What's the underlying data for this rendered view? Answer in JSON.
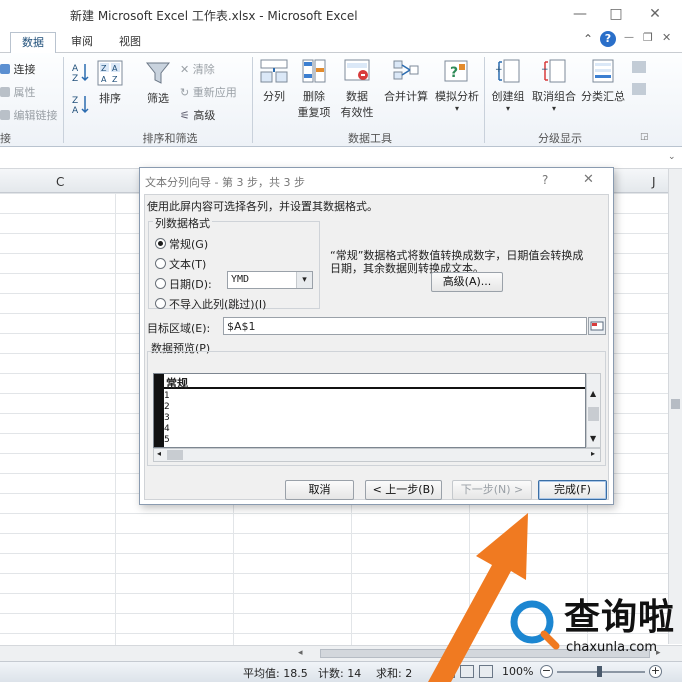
{
  "window": {
    "title": "新建 Microsoft Excel 工作表.xlsx  -  Microsoft Excel",
    "controls": [
      "—",
      "□",
      "✕"
    ]
  },
  "tabs": [
    {
      "label": "数据",
      "active": true
    },
    {
      "label": "审阅",
      "active": false
    },
    {
      "label": "视图",
      "active": false
    }
  ],
  "ribbon_right_icons": [
    "⌃",
    "?",
    "—",
    "❐",
    "✕"
  ],
  "ribbon": {
    "connections": {
      "items": [
        "连接",
        "属性",
        "编辑链接"
      ],
      "label": "接"
    },
    "sort_filter": {
      "sort_label": "排序",
      "filter_label": "筛选",
      "clear": "清除",
      "reapply": "重新应用",
      "advanced": "高级",
      "label": "排序和筛选"
    },
    "data_tools": {
      "split": "分列",
      "remove_dup_1": "删除",
      "remove_dup_2": "重复项",
      "validation_1": "数据",
      "validation_2": "有效性",
      "consolidate": "合并计算",
      "whatif": "模拟分析",
      "label": "数据工具"
    },
    "outline": {
      "group": "创建组",
      "ungroup": "取消组合",
      "subtotal": "分类汇总",
      "label": "分级显示"
    }
  },
  "columns": {
    "c": "C",
    "j": "J"
  },
  "dialog": {
    "title": "文本分列向导 - 第 3 步，共 3 步",
    "help": "?",
    "close": "✕",
    "intro": "使用此屏内容可选择各列，并设置其数据格式。",
    "group_label": "列数据格式",
    "options": [
      {
        "label": "常规(G)",
        "selected": true
      },
      {
        "label": "文本(T)",
        "selected": false
      },
      {
        "label": "日期(D):",
        "selected": false
      },
      {
        "label": "不导入此列(跳过)(I)",
        "selected": false
      }
    ],
    "date_format": "YMD",
    "description_1": "“常规”数据格式将数值转换成数字，日期值会转换成",
    "description_2": "日期，其余数据则转换成文本。",
    "advanced_button": "高级(A)...",
    "dest_label": "目标区域(E):",
    "dest_value": "$A$1",
    "preview_label": "数据预览(P)",
    "preview_header": "常规",
    "preview_rows": [
      "1",
      "2",
      "3",
      "4",
      "5"
    ],
    "buttons": {
      "cancel": "取消",
      "back": "< 上一步(B)",
      "next": "下一步(N) >",
      "finish": "完成(F)"
    }
  },
  "status": {
    "average": "平均值: 18.5",
    "count": "计数: 14",
    "sum": "求和: 2",
    "zoom": "100%"
  },
  "logo": {
    "text": "查询啦",
    "domain": "chaxunla.com"
  },
  "colors": {
    "accent": "#1e4e79",
    "arrow": "#f07a21",
    "logo_blue": "#1c86d1"
  }
}
